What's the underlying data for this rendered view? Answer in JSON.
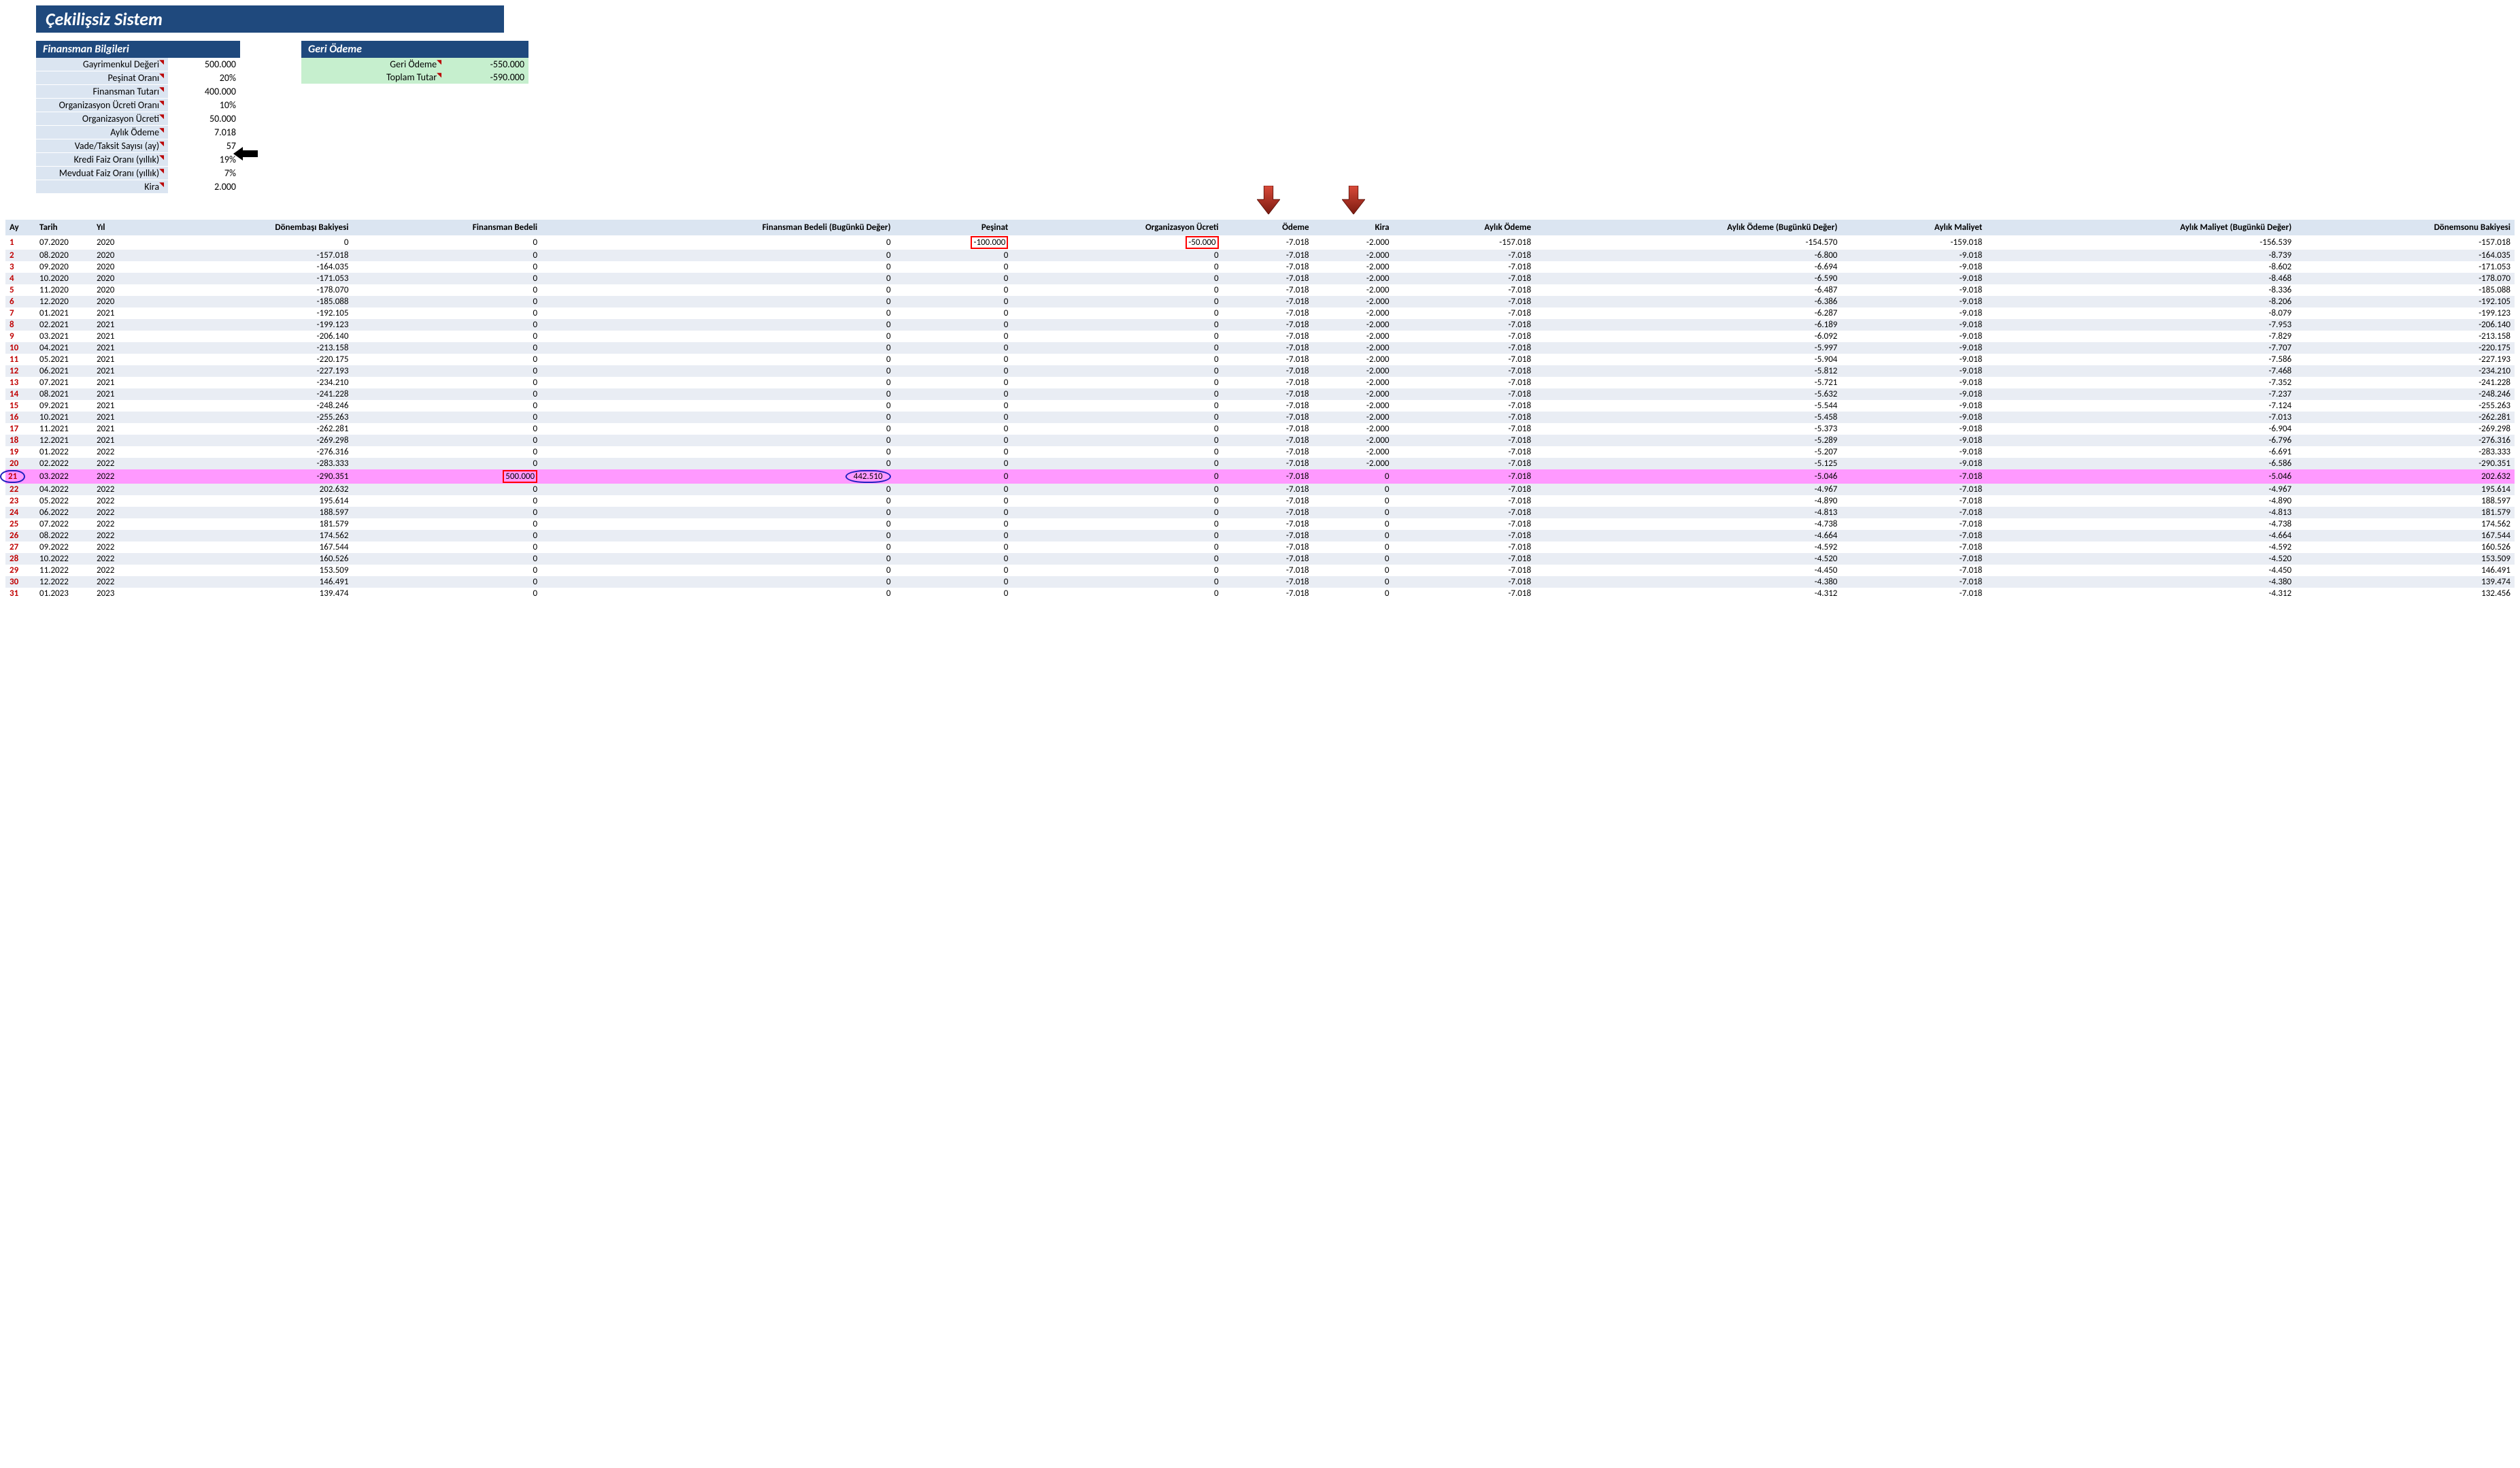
{
  "title": "Çekilişsiz Sistem",
  "fin": {
    "header": "Finansman Bilgileri",
    "rows": [
      {
        "label": "Gayrimenkul Değeri",
        "value": "500.000"
      },
      {
        "label": "Peşinat Oranı",
        "value": "20%"
      },
      {
        "label": "Finansman Tutarı",
        "value": "400.000"
      },
      {
        "label": "Organizasyon Ücreti Oranı",
        "value": "10%"
      },
      {
        "label": "Organizasyon Ücreti",
        "value": "50.000"
      },
      {
        "label": "Aylık Ödeme",
        "value": "7.018"
      },
      {
        "label": "Vade/Taksit Sayısı (ay)",
        "value": "57"
      },
      {
        "label": "Kredi Faiz Oranı (yıllık)",
        "value": "19%"
      },
      {
        "label": "Mevduat Faiz Oranı (yıllık)",
        "value": "7%"
      },
      {
        "label": "Kira",
        "value": "2.000"
      }
    ]
  },
  "go": {
    "header": "Geri Ödeme",
    "rows": [
      {
        "label": "Geri Ödeme",
        "value": "-550.000"
      },
      {
        "label": "Toplam Tutar",
        "value": "-590.000"
      }
    ]
  },
  "columns": [
    "Ay",
    "Tarih",
    "Yıl",
    "Dönembaşı Bakiyesi",
    "Finansman Bedeli",
    "Finansman Bedeli (Bugünkü Değer)",
    "Peşinat",
    "Organizasyon Ücreti",
    "Ödeme",
    "Kira",
    "Aylık Ödeme",
    "Aylık Ödeme (Bugünkü Değer)",
    "Aylık Maliyet",
    "Aylık Maliyet (Bugünkü Değer)",
    "Dönemsonu Bakiyesi"
  ],
  "rows": [
    {
      "ay": "1",
      "tarih": "07.2020",
      "yil": "2020",
      "db": "0",
      "fb": "0",
      "fbd": "0",
      "pes": "-100.000",
      "org": "-50.000",
      "ode": "-7.018",
      "kira": "-2.000",
      "ao": "-157.018",
      "aod": "-154.570",
      "am": "-159.018",
      "amd": "-156.539",
      "dsb": "-157.018"
    },
    {
      "ay": "2",
      "tarih": "08.2020",
      "yil": "2020",
      "db": "-157.018",
      "fb": "0",
      "fbd": "0",
      "pes": "0",
      "org": "0",
      "ode": "-7.018",
      "kira": "-2.000",
      "ao": "-7.018",
      "aod": "-6.800",
      "am": "-9.018",
      "amd": "-8.739",
      "dsb": "-164.035"
    },
    {
      "ay": "3",
      "tarih": "09.2020",
      "yil": "2020",
      "db": "-164.035",
      "fb": "0",
      "fbd": "0",
      "pes": "0",
      "org": "0",
      "ode": "-7.018",
      "kira": "-2.000",
      "ao": "-7.018",
      "aod": "-6.694",
      "am": "-9.018",
      "amd": "-8.602",
      "dsb": "-171.053"
    },
    {
      "ay": "4",
      "tarih": "10.2020",
      "yil": "2020",
      "db": "-171.053",
      "fb": "0",
      "fbd": "0",
      "pes": "0",
      "org": "0",
      "ode": "-7.018",
      "kira": "-2.000",
      "ao": "-7.018",
      "aod": "-6.590",
      "am": "-9.018",
      "amd": "-8.468",
      "dsb": "-178.070"
    },
    {
      "ay": "5",
      "tarih": "11.2020",
      "yil": "2020",
      "db": "-178.070",
      "fb": "0",
      "fbd": "0",
      "pes": "0",
      "org": "0",
      "ode": "-7.018",
      "kira": "-2.000",
      "ao": "-7.018",
      "aod": "-6.487",
      "am": "-9.018",
      "amd": "-8.336",
      "dsb": "-185.088"
    },
    {
      "ay": "6",
      "tarih": "12.2020",
      "yil": "2020",
      "db": "-185.088",
      "fb": "0",
      "fbd": "0",
      "pes": "0",
      "org": "0",
      "ode": "-7.018",
      "kira": "-2.000",
      "ao": "-7.018",
      "aod": "-6.386",
      "am": "-9.018",
      "amd": "-8.206",
      "dsb": "-192.105"
    },
    {
      "ay": "7",
      "tarih": "01.2021",
      "yil": "2021",
      "db": "-192.105",
      "fb": "0",
      "fbd": "0",
      "pes": "0",
      "org": "0",
      "ode": "-7.018",
      "kira": "-2.000",
      "ao": "-7.018",
      "aod": "-6.287",
      "am": "-9.018",
      "amd": "-8.079",
      "dsb": "-199.123"
    },
    {
      "ay": "8",
      "tarih": "02.2021",
      "yil": "2021",
      "db": "-199.123",
      "fb": "0",
      "fbd": "0",
      "pes": "0",
      "org": "0",
      "ode": "-7.018",
      "kira": "-2.000",
      "ao": "-7.018",
      "aod": "-6.189",
      "am": "-9.018",
      "amd": "-7.953",
      "dsb": "-206.140"
    },
    {
      "ay": "9",
      "tarih": "03.2021",
      "yil": "2021",
      "db": "-206.140",
      "fb": "0",
      "fbd": "0",
      "pes": "0",
      "org": "0",
      "ode": "-7.018",
      "kira": "-2.000",
      "ao": "-7.018",
      "aod": "-6.092",
      "am": "-9.018",
      "amd": "-7.829",
      "dsb": "-213.158"
    },
    {
      "ay": "10",
      "tarih": "04.2021",
      "yil": "2021",
      "db": "-213.158",
      "fb": "0",
      "fbd": "0",
      "pes": "0",
      "org": "0",
      "ode": "-7.018",
      "kira": "-2.000",
      "ao": "-7.018",
      "aod": "-5.997",
      "am": "-9.018",
      "amd": "-7.707",
      "dsb": "-220.175"
    },
    {
      "ay": "11",
      "tarih": "05.2021",
      "yil": "2021",
      "db": "-220.175",
      "fb": "0",
      "fbd": "0",
      "pes": "0",
      "org": "0",
      "ode": "-7.018",
      "kira": "-2.000",
      "ao": "-7.018",
      "aod": "-5.904",
      "am": "-9.018",
      "amd": "-7.586",
      "dsb": "-227.193"
    },
    {
      "ay": "12",
      "tarih": "06.2021",
      "yil": "2021",
      "db": "-227.193",
      "fb": "0",
      "fbd": "0",
      "pes": "0",
      "org": "0",
      "ode": "-7.018",
      "kira": "-2.000",
      "ao": "-7.018",
      "aod": "-5.812",
      "am": "-9.018",
      "amd": "-7.468",
      "dsb": "-234.210"
    },
    {
      "ay": "13",
      "tarih": "07.2021",
      "yil": "2021",
      "db": "-234.210",
      "fb": "0",
      "fbd": "0",
      "pes": "0",
      "org": "0",
      "ode": "-7.018",
      "kira": "-2.000",
      "ao": "-7.018",
      "aod": "-5.721",
      "am": "-9.018",
      "amd": "-7.352",
      "dsb": "-241.228"
    },
    {
      "ay": "14",
      "tarih": "08.2021",
      "yil": "2021",
      "db": "-241.228",
      "fb": "0",
      "fbd": "0",
      "pes": "0",
      "org": "0",
      "ode": "-7.018",
      "kira": "-2.000",
      "ao": "-7.018",
      "aod": "-5.632",
      "am": "-9.018",
      "amd": "-7.237",
      "dsb": "-248.246"
    },
    {
      "ay": "15",
      "tarih": "09.2021",
      "yil": "2021",
      "db": "-248.246",
      "fb": "0",
      "fbd": "0",
      "pes": "0",
      "org": "0",
      "ode": "-7.018",
      "kira": "-2.000",
      "ao": "-7.018",
      "aod": "-5.544",
      "am": "-9.018",
      "amd": "-7.124",
      "dsb": "-255.263"
    },
    {
      "ay": "16",
      "tarih": "10.2021",
      "yil": "2021",
      "db": "-255.263",
      "fb": "0",
      "fbd": "0",
      "pes": "0",
      "org": "0",
      "ode": "-7.018",
      "kira": "-2.000",
      "ao": "-7.018",
      "aod": "-5.458",
      "am": "-9.018",
      "amd": "-7.013",
      "dsb": "-262.281"
    },
    {
      "ay": "17",
      "tarih": "11.2021",
      "yil": "2021",
      "db": "-262.281",
      "fb": "0",
      "fbd": "0",
      "pes": "0",
      "org": "0",
      "ode": "-7.018",
      "kira": "-2.000",
      "ao": "-7.018",
      "aod": "-5.373",
      "am": "-9.018",
      "amd": "-6.904",
      "dsb": "-269.298"
    },
    {
      "ay": "18",
      "tarih": "12.2021",
      "yil": "2021",
      "db": "-269.298",
      "fb": "0",
      "fbd": "0",
      "pes": "0",
      "org": "0",
      "ode": "-7.018",
      "kira": "-2.000",
      "ao": "-7.018",
      "aod": "-5.289",
      "am": "-9.018",
      "amd": "-6.796",
      "dsb": "-276.316"
    },
    {
      "ay": "19",
      "tarih": "01.2022",
      "yil": "2022",
      "db": "-276.316",
      "fb": "0",
      "fbd": "0",
      "pes": "0",
      "org": "0",
      "ode": "-7.018",
      "kira": "-2.000",
      "ao": "-7.018",
      "aod": "-5.207",
      "am": "-9.018",
      "amd": "-6.691",
      "dsb": "-283.333"
    },
    {
      "ay": "20",
      "tarih": "02.2022",
      "yil": "2022",
      "db": "-283.333",
      "fb": "0",
      "fbd": "0",
      "pes": "0",
      "org": "0",
      "ode": "-7.018",
      "kira": "-2.000",
      "ao": "-7.018",
      "aod": "-5.125",
      "am": "-9.018",
      "amd": "-6.586",
      "dsb": "-290.351"
    },
    {
      "ay": "21",
      "tarih": "03.2022",
      "yil": "2022",
      "db": "-290.351",
      "fb": "500.000",
      "fbd": "442.510",
      "pes": "0",
      "org": "0",
      "ode": "-7.018",
      "kira": "0",
      "ao": "-7.018",
      "aod": "-5.046",
      "am": "-7.018",
      "amd": "-5.046",
      "dsb": "202.632",
      "pink": true
    },
    {
      "ay": "22",
      "tarih": "04.2022",
      "yil": "2022",
      "db": "202.632",
      "fb": "0",
      "fbd": "0",
      "pes": "0",
      "org": "0",
      "ode": "-7.018",
      "kira": "0",
      "ao": "-7.018",
      "aod": "-4.967",
      "am": "-7.018",
      "amd": "-4.967",
      "dsb": "195.614"
    },
    {
      "ay": "23",
      "tarih": "05.2022",
      "yil": "2022",
      "db": "195.614",
      "fb": "0",
      "fbd": "0",
      "pes": "0",
      "org": "0",
      "ode": "-7.018",
      "kira": "0",
      "ao": "-7.018",
      "aod": "-4.890",
      "am": "-7.018",
      "amd": "-4.890",
      "dsb": "188.597"
    },
    {
      "ay": "24",
      "tarih": "06.2022",
      "yil": "2022",
      "db": "188.597",
      "fb": "0",
      "fbd": "0",
      "pes": "0",
      "org": "0",
      "ode": "-7.018",
      "kira": "0",
      "ao": "-7.018",
      "aod": "-4.813",
      "am": "-7.018",
      "amd": "-4.813",
      "dsb": "181.579"
    },
    {
      "ay": "25",
      "tarih": "07.2022",
      "yil": "2022",
      "db": "181.579",
      "fb": "0",
      "fbd": "0",
      "pes": "0",
      "org": "0",
      "ode": "-7.018",
      "kira": "0",
      "ao": "-7.018",
      "aod": "-4.738",
      "am": "-7.018",
      "amd": "-4.738",
      "dsb": "174.562"
    },
    {
      "ay": "26",
      "tarih": "08.2022",
      "yil": "2022",
      "db": "174.562",
      "fb": "0",
      "fbd": "0",
      "pes": "0",
      "org": "0",
      "ode": "-7.018",
      "kira": "0",
      "ao": "-7.018",
      "aod": "-4.664",
      "am": "-7.018",
      "amd": "-4.664",
      "dsb": "167.544"
    },
    {
      "ay": "27",
      "tarih": "09.2022",
      "yil": "2022",
      "db": "167.544",
      "fb": "0",
      "fbd": "0",
      "pes": "0",
      "org": "0",
      "ode": "-7.018",
      "kira": "0",
      "ao": "-7.018",
      "aod": "-4.592",
      "am": "-7.018",
      "amd": "-4.592",
      "dsb": "160.526"
    },
    {
      "ay": "28",
      "tarih": "10.2022",
      "yil": "2022",
      "db": "160.526",
      "fb": "0",
      "fbd": "0",
      "pes": "0",
      "org": "0",
      "ode": "-7.018",
      "kira": "0",
      "ao": "-7.018",
      "aod": "-4.520",
      "am": "-7.018",
      "amd": "-4.520",
      "dsb": "153.509"
    },
    {
      "ay": "29",
      "tarih": "11.2022",
      "yil": "2022",
      "db": "153.509",
      "fb": "0",
      "fbd": "0",
      "pes": "0",
      "org": "0",
      "ode": "-7.018",
      "kira": "0",
      "ao": "-7.018",
      "aod": "-4.450",
      "am": "-7.018",
      "amd": "-4.450",
      "dsb": "146.491"
    },
    {
      "ay": "30",
      "tarih": "12.2022",
      "yil": "2022",
      "db": "146.491",
      "fb": "0",
      "fbd": "0",
      "pes": "0",
      "org": "0",
      "ode": "-7.018",
      "kira": "0",
      "ao": "-7.018",
      "aod": "-4.380",
      "am": "-7.018",
      "amd": "-4.380",
      "dsb": "139.474"
    },
    {
      "ay": "31",
      "tarih": "01.2023",
      "yil": "2023",
      "db": "139.474",
      "fb": "0",
      "fbd": "0",
      "pes": "0",
      "org": "0",
      "ode": "-7.018",
      "kira": "0",
      "ao": "-7.018",
      "aod": "-4.312",
      "am": "-7.018",
      "amd": "-4.312",
      "dsb": "132.456"
    }
  ],
  "annotations": {
    "row1_redbox_cols": [
      "pes",
      "org"
    ],
    "row21_redbox_col": "fb",
    "row21_bluecircle_col": "fbd",
    "row21_bluecircle_ay": true,
    "red_down_arrows_over_cols": [
      "ode",
      "kira"
    ],
    "black_left_arrow_on_fin_row_index": 7
  }
}
